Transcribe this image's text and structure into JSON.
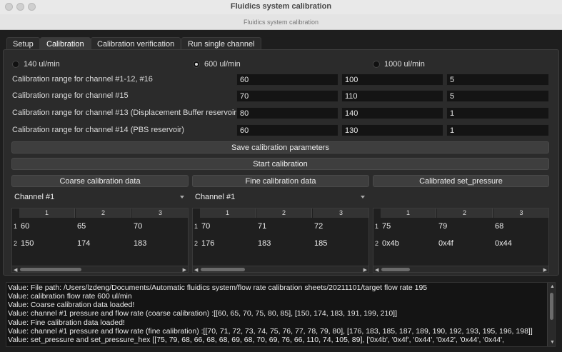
{
  "window": {
    "title": "Fluidics system calibration",
    "subtitle": "Fluidics system calibration"
  },
  "tabs": [
    "Setup",
    "Calibration",
    "Calibration verification",
    "Run single channel"
  ],
  "flow_rates": [
    {
      "label": "140 ul/min",
      "selected": false
    },
    {
      "label": "600 ul/min",
      "selected": true
    },
    {
      "label": "1000 ul/min",
      "selected": false
    }
  ],
  "ranges": [
    {
      "label": "Calibration range for channel #1-12, #16",
      "values": [
        "60",
        "100",
        "5"
      ]
    },
    {
      "label": "Calibration range for channel #15",
      "values": [
        "70",
        "110",
        "5"
      ]
    },
    {
      "label": "Calibration range for channel #13 (Displacement Buffer reservoir)",
      "values": [
        "80",
        "140",
        "1"
      ]
    },
    {
      "label": "Calibration range for channel #14 (PBS reservoir)",
      "values": [
        "60",
        "130",
        "1"
      ]
    }
  ],
  "buttons": {
    "save": "Save calibration parameters",
    "start": "Start calibration",
    "coarse": "Coarse calibration data",
    "fine": "Fine calibration data",
    "calibrated": "Calibrated set_pressure"
  },
  "selects": {
    "coarse_channel": "Channel #1",
    "fine_channel": "Channel #1"
  },
  "tables": {
    "coarse": {
      "columns": [
        "1",
        "2",
        "3"
      ],
      "rows": [
        {
          "label": "1",
          "cells": [
            "60",
            "65",
            "70"
          ]
        },
        {
          "label": "2",
          "cells": [
            "150",
            "174",
            "183"
          ]
        }
      ]
    },
    "fine": {
      "columns": [
        "1",
        "2",
        "3"
      ],
      "rows": [
        {
          "label": "1",
          "cells": [
            "70",
            "71",
            "72"
          ]
        },
        {
          "label": "2",
          "cells": [
            "176",
            "183",
            "185"
          ]
        }
      ]
    },
    "calibrated": {
      "columns": [
        "1",
        "2",
        "3"
      ],
      "rows": [
        {
          "label": "1",
          "cells": [
            "75",
            "79",
            "68"
          ]
        },
        {
          "label": "2",
          "cells": [
            "0x4b",
            "0x4f",
            "0x44"
          ]
        }
      ]
    }
  },
  "log": [
    "Value: File path: /Users/lzdeng/Documents/Automatic fluidics system/flow rate calibration sheets/20211101/target flow rate 195",
    "Value: calibration flow rate 600 ul/min",
    "Value: Coarse calibration data loaded!",
    "Value: channel #1 pressure and flow rate (coarse calibration) :[[60, 65, 70, 75, 80, 85], [150, 174, 183, 191, 199, 210]]",
    "Value: Fine calibration data loaded!",
    "Value: channel #1 pressure and flow rate (fine calibration) :[[70, 71, 72, 73, 74, 75, 76, 77, 78, 79, 80], [176, 183, 185, 187, 189, 190, 192, 193, 195, 196, 198]]",
    "Value: set_pressure and set_pressure_hex [[75, 79, 68, 66, 68, 68, 69, 68, 70, 69, 76, 66, 110, 74, 105, 89], ['0x4b', '0x4f', '0x44', '0x42', '0x44', '0x44',"
  ]
}
